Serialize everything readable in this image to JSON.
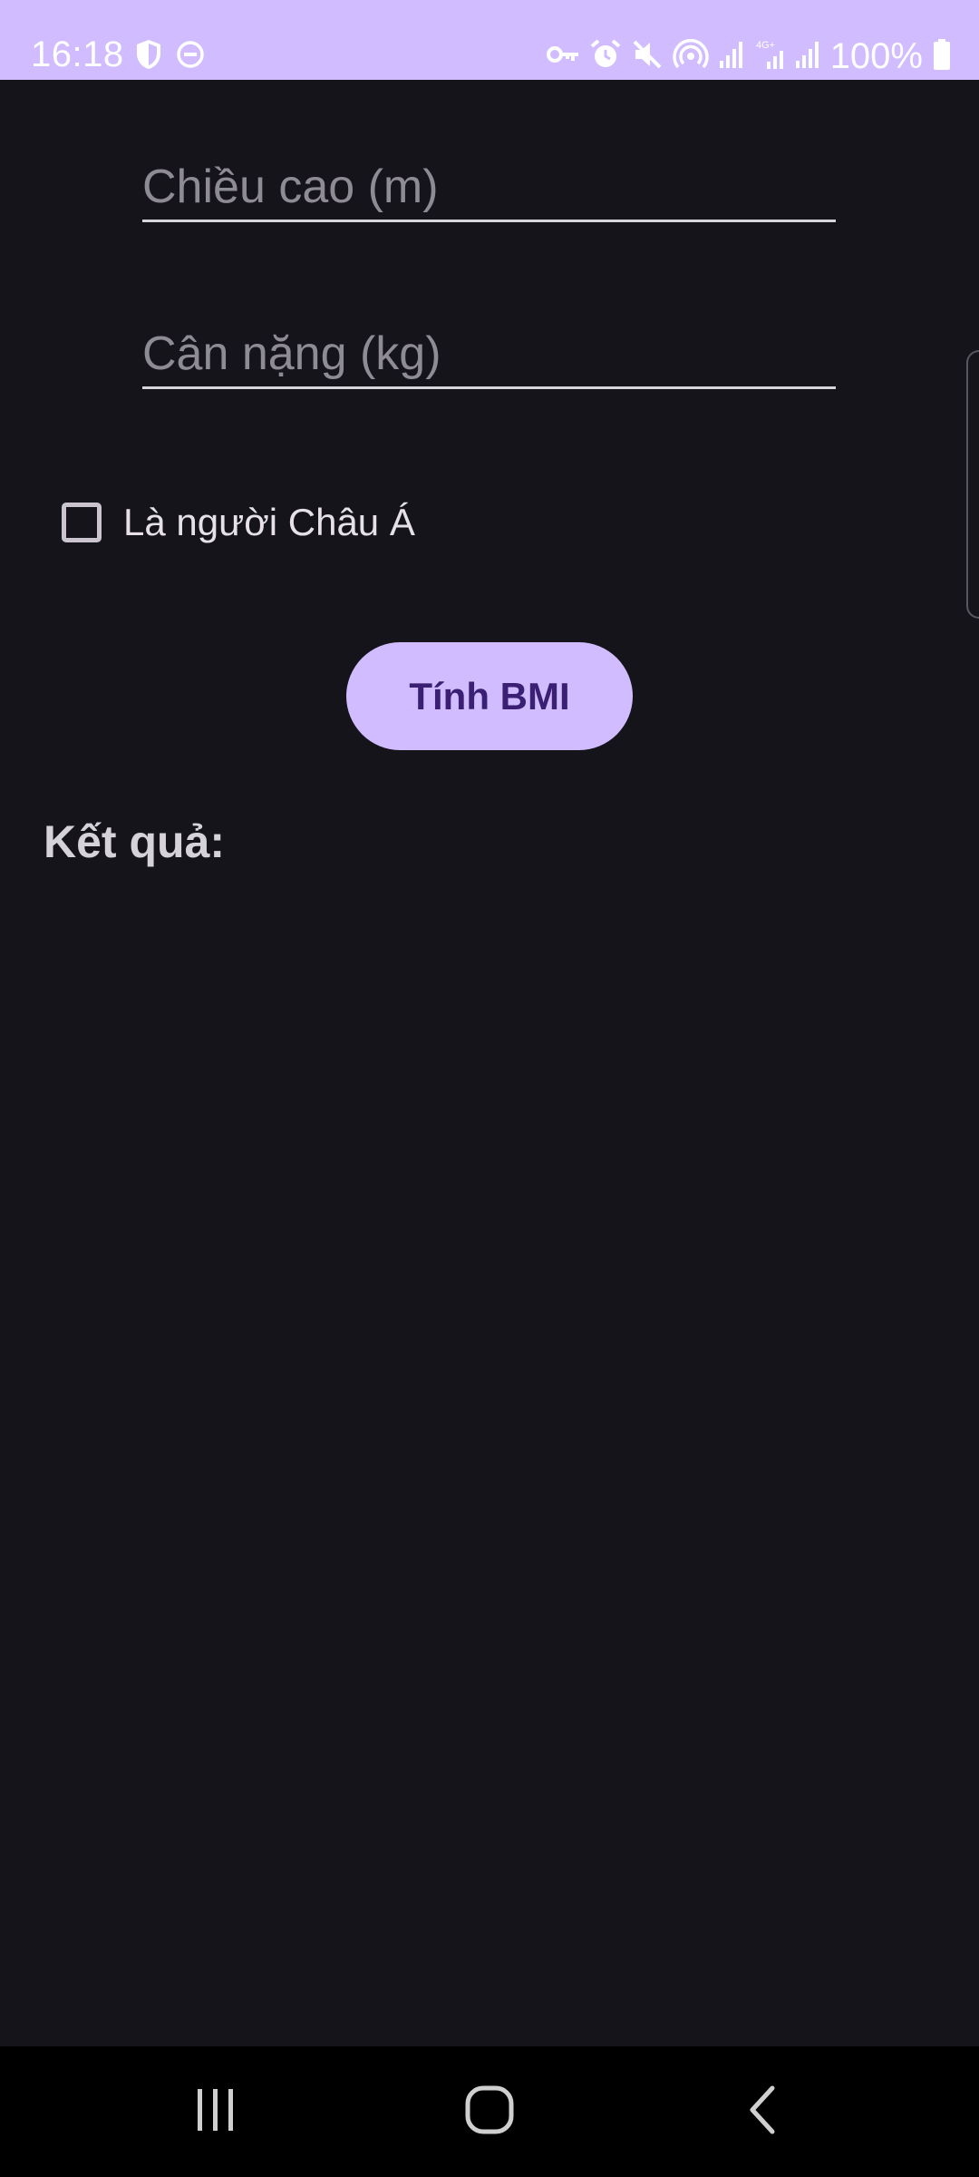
{
  "status_bar": {
    "time": "16:18",
    "battery_text": "100%",
    "left_icons": [
      "shield-icon",
      "do-not-disturb-icon"
    ],
    "right_icons": [
      "vpn-key-icon",
      "alarm-icon",
      "mute-icon",
      "hotspot-icon",
      "signal-icon",
      "signal-4g-icon",
      "signal-icon",
      "battery-icon"
    ],
    "background_color": "#d0bcff"
  },
  "form": {
    "height_placeholder": "Chiều cao (m)",
    "height_value": "",
    "weight_placeholder": "Cân nặng (kg)",
    "weight_value": "",
    "asian_checkbox_label": "Là người Châu Á",
    "asian_checked": false,
    "calculate_button_label": "Tính BMI"
  },
  "result": {
    "label": "Kết quả:"
  },
  "nav_bar": {
    "buttons": [
      "recents-icon",
      "home-icon",
      "back-icon"
    ]
  },
  "colors": {
    "background": "#16141b",
    "accent": "#d0bcff",
    "button_text": "#3a1f72"
  }
}
